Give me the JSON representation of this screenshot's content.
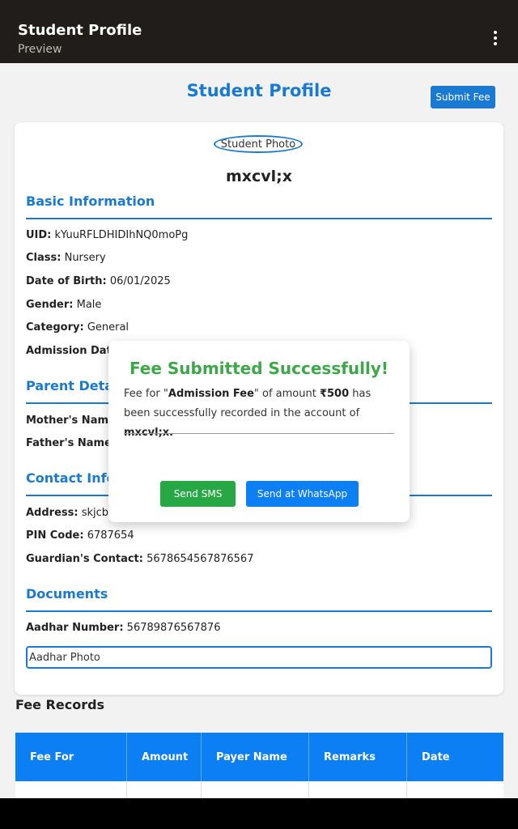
{
  "appbar": {
    "title": "Student Profile",
    "subtitle": "Preview",
    "menu_icon": "more-vertical-icon"
  },
  "header": {
    "page_title": "Student Profile",
    "submit_fee_label": "Submit Fee"
  },
  "profile": {
    "photo_alt": "Student Photo",
    "name": "mxcvl;x",
    "basic": {
      "heading": "Basic Information",
      "uid_label": "UID:",
      "uid": "kYuuRFLDHIDIhNQ0moPg",
      "class_label": "Class:",
      "class": "Nursery",
      "dob_label": "Date of Birth:",
      "dob": "06/01/2025",
      "gender_label": "Gender:",
      "gender": "Male",
      "category_label": "Category:",
      "category": "General",
      "admission_label": "Admission Date"
    },
    "parent": {
      "heading": "Parent Detail",
      "mother_label": "Mother's Name:",
      "father_label": "Father's Name:"
    },
    "contact": {
      "heading": "Contact Infor",
      "address_label": "Address:",
      "address": "skjcbk",
      "pin_label": "PIN Code:",
      "pin": "6787654",
      "guardian_label": "Guardian's Contact:",
      "guardian": "5678654567876567"
    },
    "documents": {
      "heading": "Documents",
      "aadhar_label": "Aadhar Number:",
      "aadhar": "56789876567876",
      "aadhar_photo_alt": "Aadhar Photo"
    }
  },
  "fee_records": {
    "heading": "Fee Records",
    "columns": [
      "Fee For",
      "Amount",
      "Payer Name",
      "Remarks",
      "Date"
    ]
  },
  "modal": {
    "title": "Fee Submitted Successfully!",
    "msg_prefix": "Fee for \"",
    "fee_name": "Admission Fee",
    "msg_mid": "\" of amount ",
    "amount": "₹500",
    "msg_suffix": " has been successfully recorded in the account of ",
    "student": "mxcvl;x.",
    "sms_label": "Send SMS",
    "whatsapp_label": "Send at WhatsApp"
  },
  "colors": {
    "primary": "#1a7ad1",
    "success": "#28a745",
    "table_header": "#0d7ff5",
    "appbar": "#211d1a"
  }
}
